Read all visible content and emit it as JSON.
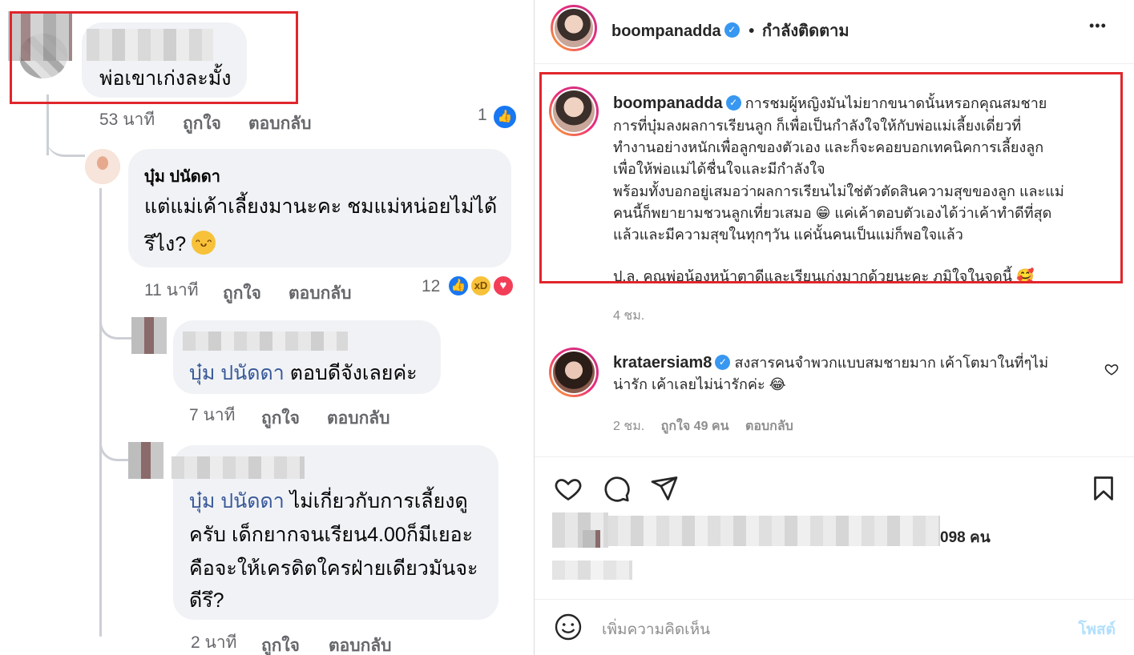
{
  "facebook": {
    "comment1": {
      "text": "พ่อเขาเก่งละมั้ง",
      "time": "53 นาที",
      "like": "ถูกใจ",
      "reply": "ตอบกลับ",
      "reaction_count": "1"
    },
    "comment2": {
      "author": "บุ๋ม ปนัดดา",
      "line1": "แต่แม่เค้าเลี้ยงมานะคะ ชมแม่หน่อยไม่ได้",
      "line2": "รึไง?",
      "time": "11 นาที",
      "like": "ถูกใจ",
      "reply": "ตอบกลับ",
      "reaction_count": "12"
    },
    "comment3": {
      "mention": "บุ๋ม ปนัดดา",
      "text": "ตอบดีจังเลยค่ะ",
      "time": "7 นาที",
      "like": "ถูกใจ",
      "reply": "ตอบกลับ"
    },
    "comment4": {
      "mention": "บุ๋ม ปนัดดา",
      "line1": "ไม่เกี่ยวกับการเลี้ยงดู",
      "line2": "ครับ เด็กยากจนเรียน4.00ก็มีเยอะ",
      "line3": "คือจะให้เครดิตใครฝ่ายเดียวมันจะ",
      "line4": "ดีรึ?",
      "time": "2 นาที",
      "like": "ถูกใจ",
      "reply": "ตอบกลับ"
    }
  },
  "instagram": {
    "header": {
      "username": "boompanadda",
      "separator": "•",
      "follow_status": "กำลังติดตาม",
      "more": "•••"
    },
    "caption": {
      "username": "boompanadda",
      "lines": [
        "การชมผู้หญิงมันไม่ยากขนาดนั้นหรอกคุณสมชาย",
        "การที่บุ๋มลงผลการเรียนลูก ก็เพื่อเป็นกำลังใจให้กับพ่อแม่เลี้ยงเดี่ยวที่",
        "ทำงานอย่างหนักเพื่อลูกของตัวเอง และก็จะคอยบอกเทคนิคการเลี้ยงลูก",
        "เพื่อให้พ่อแม่ได้ชื่นใจและมีกำลังใจ",
        "พร้อมทั้งบอกอยู่เสมอว่าผลการเรียนไม่ใช่ตัวตัดสินความสุขของลูก และแม่",
        "คนนี้ก็พยายามชวนลูกเที่ยวเสมอ 😁 แค่เค้าตอบตัวเองได้ว่าเค้าทำดีที่สุด",
        "แล้วและมีความสุขในทุกๆวัน แค่นั้นคนเป็นแม่ก็พอใจแล้ว",
        "",
        "ป.ล. คุณพ่อน้องหน้าตาดีและเรียนเก่งมากด้วยนะคะ ภูมิใจในจุดนี้ 🥰"
      ],
      "time": "4 ชม."
    },
    "comment": {
      "username": "krataersiam8",
      "line1": "สงสารคนจำพวกแบบสมชายมาก เค้าโตมาในที่ๆไม่",
      "line2": "น่ารัก เค้าเลยไม่น่ารักค่ะ 😂",
      "time": "2 ชม.",
      "likes": "ถูกใจ 49 คน",
      "reply": "ตอบกลับ"
    },
    "likes_suffix": "098 คน",
    "comment_placeholder": "เพิ่มความคิดเห็น",
    "post_button": "โพสต์",
    "colors": {
      "verified": "#3897f0",
      "highlight_box": "#e0262b",
      "fb_link": "#385898"
    }
  }
}
